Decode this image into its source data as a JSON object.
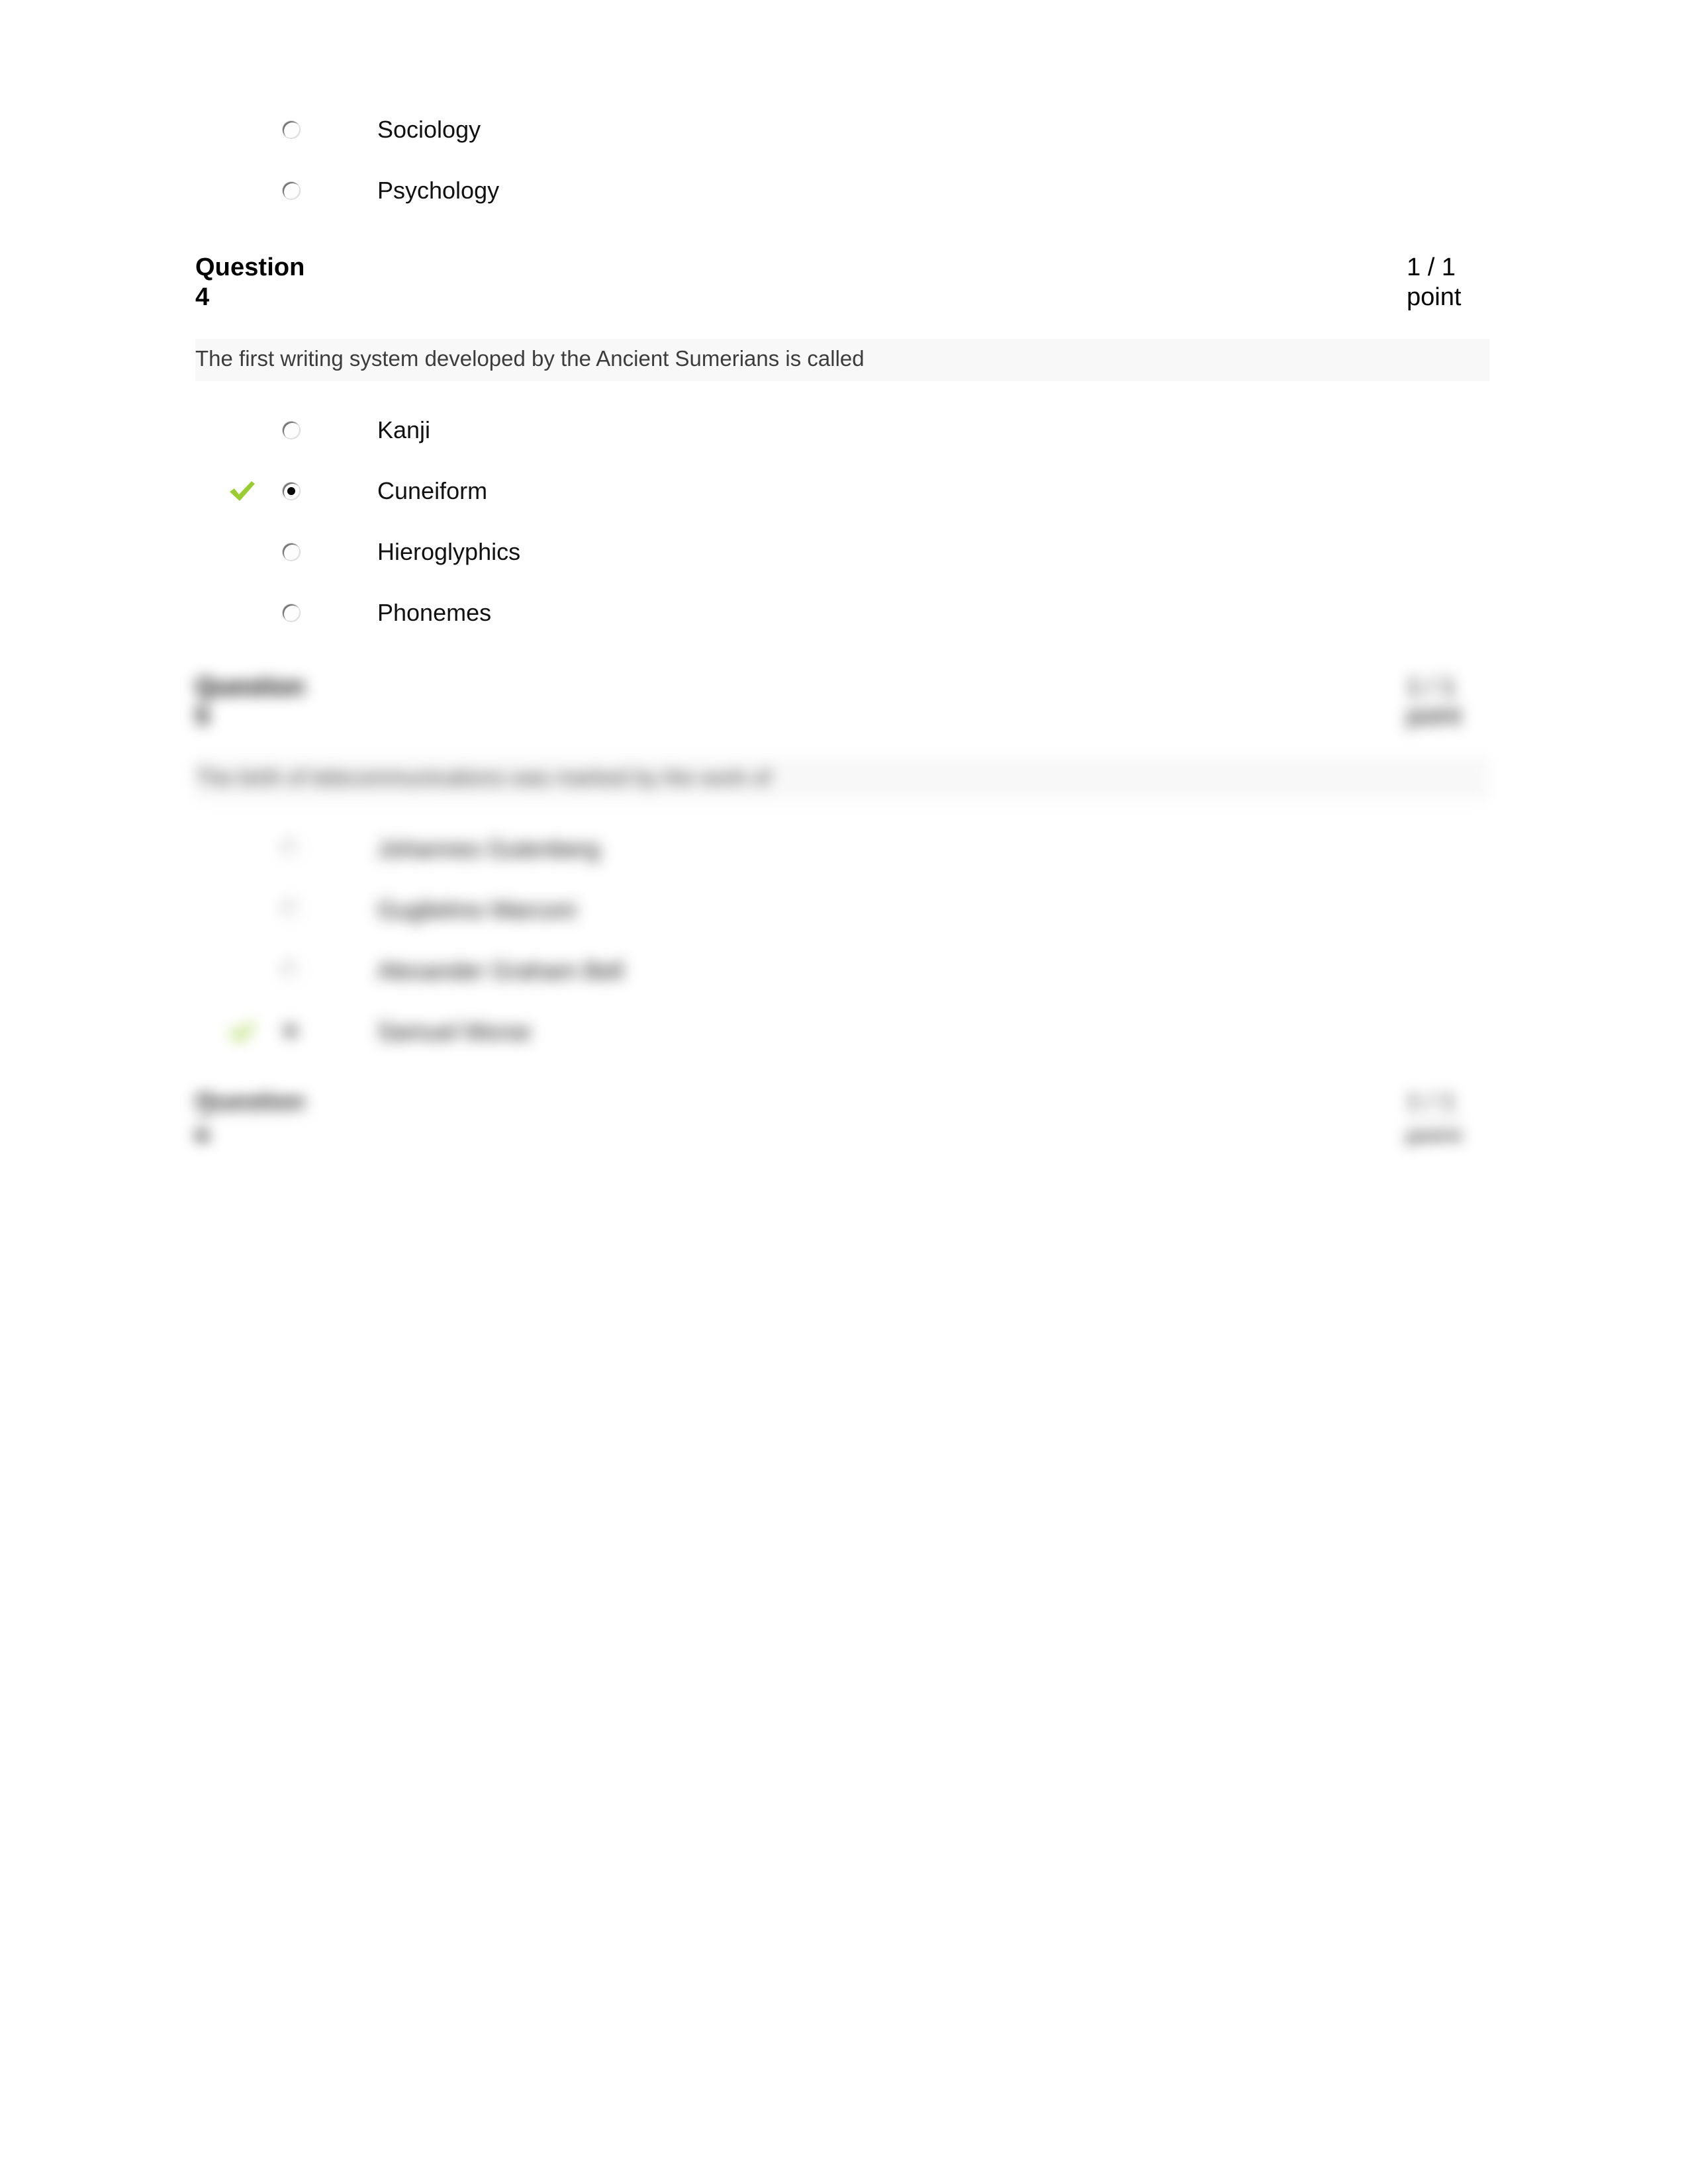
{
  "document": {
    "type": "quiz-review-page",
    "background_color": "#ffffff",
    "prompt_band_color": "#f8f8f8",
    "correct_mark_color": "#9ACD32",
    "text_color": "#111111"
  },
  "previous_question_tail": {
    "options": [
      {
        "label": "Sociology",
        "selected": false,
        "correct_mark": false
      },
      {
        "label": "Psychology",
        "selected": false,
        "correct_mark": false
      }
    ]
  },
  "questions": [
    {
      "id": "q4",
      "label": "Question",
      "number": "4",
      "points_value": "1 / 1",
      "points_unit": "point",
      "prompt": "The first writing system developed by the Ancient Sumerians is called",
      "blur": "none",
      "options": [
        {
          "label": "Kanji",
          "selected": false,
          "correct_mark": false
        },
        {
          "label": "Cuneiform",
          "selected": true,
          "correct_mark": true
        },
        {
          "label": "Hieroglyphics",
          "selected": false,
          "correct_mark": false
        },
        {
          "label": "Phonemes",
          "selected": false,
          "correct_mark": false
        }
      ]
    },
    {
      "id": "q5",
      "label": "Question",
      "number": "5",
      "points_value": "1 / 1",
      "points_unit": "point",
      "prompt": "The birth of telecommunications was marked by the work of",
      "blur": "heavy",
      "options": [
        {
          "label": "Johannes Gutenberg",
          "selected": false,
          "correct_mark": false
        },
        {
          "label": "Guglielmo Marconi",
          "selected": false,
          "correct_mark": false
        },
        {
          "label": "Alexander Graham Bell",
          "selected": false,
          "correct_mark": false
        },
        {
          "label": "Samuel Morse",
          "selected": true,
          "correct_mark": true
        }
      ]
    },
    {
      "id": "q6",
      "label": "Question",
      "number": "6",
      "points_value": "1 / 1",
      "points_unit": "point",
      "prompt": "",
      "blur": "heavy",
      "options": []
    }
  ]
}
